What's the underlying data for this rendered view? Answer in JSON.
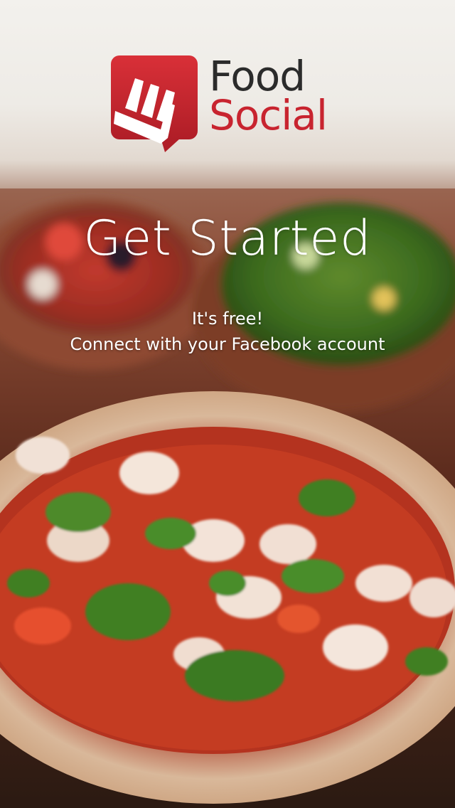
{
  "brand": {
    "name_line1": "Food",
    "name_line2": "Social",
    "accent_color": "#c8242f",
    "text_color": "#2b2b2b",
    "icon": "fork-speech-bubble-icon"
  },
  "hero": {
    "title": "Get Started",
    "line1": "It's free!",
    "line2": "Connect with your Facebook account"
  },
  "background": {
    "image": "pizza-and-salad-bowls-photo"
  }
}
